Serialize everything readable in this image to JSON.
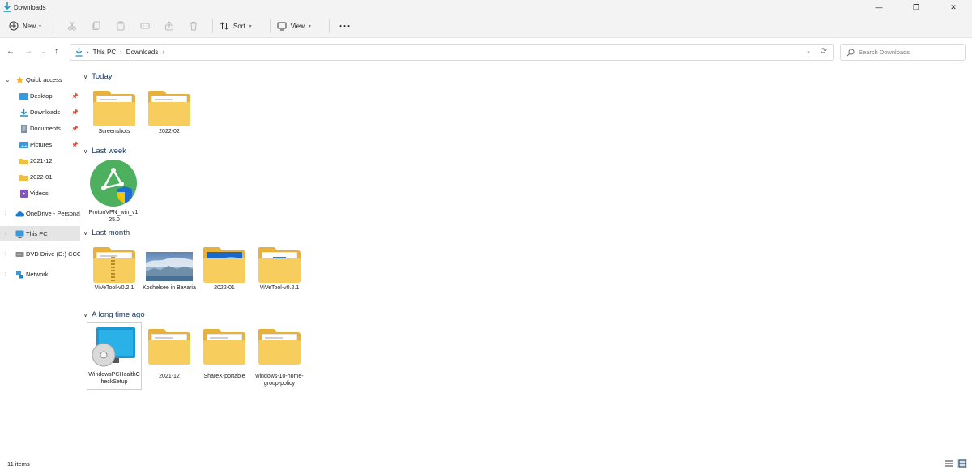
{
  "window": {
    "title": "Downloads",
    "minimize": "—",
    "restore": "❐",
    "close": "✕"
  },
  "toolbar": {
    "new_label": "New",
    "sort_label": "Sort",
    "view_label": "View",
    "more_label": "···"
  },
  "address": {
    "crumbs": [
      "This PC",
      "Downloads"
    ],
    "search_placeholder": "Search Downloads"
  },
  "sidebar": {
    "quick_access": "Quick access",
    "items": [
      {
        "label": "Desktop"
      },
      {
        "label": "Downloads"
      },
      {
        "label": "Documents"
      },
      {
        "label": "Pictures"
      },
      {
        "label": "2021-12"
      },
      {
        "label": "2022-01"
      },
      {
        "label": "Videos"
      }
    ],
    "onedrive": "OneDrive - Personal",
    "this_pc": "This PC",
    "dvd": "DVD Drive (D:) CCCOMA",
    "network": "Network"
  },
  "groups": [
    {
      "title": "Today",
      "items": [
        {
          "label": "Screenshots"
        },
        {
          "label": "2022-02"
        }
      ]
    },
    {
      "title": "Last week",
      "items": [
        {
          "label": "ProtonVPN_win_v1.25.0"
        }
      ]
    },
    {
      "title": "Last month",
      "items": [
        {
          "label": "ViVeTool-v0.2.1"
        },
        {
          "label": "Kochelsee in Bavaria"
        },
        {
          "label": "2022-01"
        },
        {
          "label": "ViVeTool-v0.2.1"
        }
      ]
    },
    {
      "title": "A long time ago",
      "items": [
        {
          "label": "WindowsPCHealthCheckSetup"
        },
        {
          "label": "2021-12"
        },
        {
          "label": "ShareX-portable"
        },
        {
          "label": "windows-10-home-group-policy"
        }
      ]
    }
  ],
  "status": {
    "count": "11 items"
  },
  "colors": {
    "folder": "#f7cd5d",
    "folder_back": "#e8b13a",
    "accent": "#0067c0",
    "selection": "#e5e5e5"
  }
}
